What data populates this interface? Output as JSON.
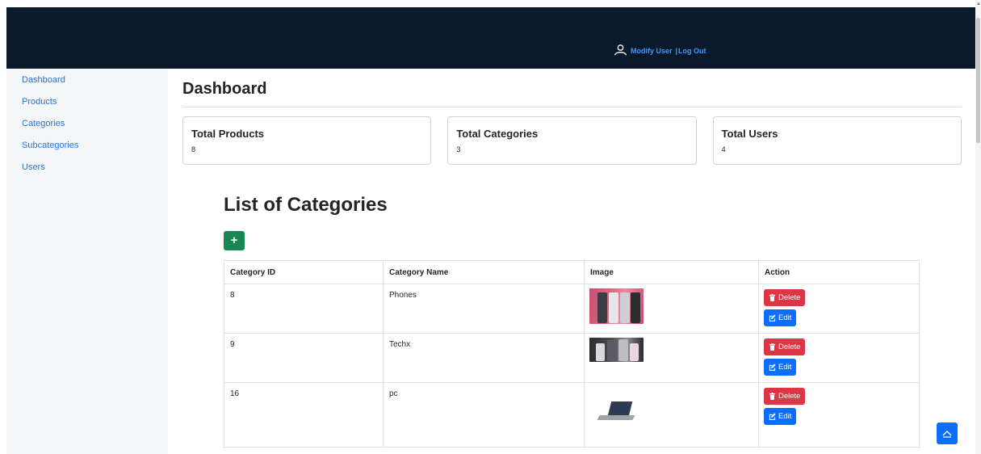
{
  "header": {
    "modify_user": "Modify User",
    "separator": "|",
    "logout": "Log Out"
  },
  "sidebar": {
    "items": [
      {
        "label": "Dashboard"
      },
      {
        "label": "Products"
      },
      {
        "label": "Categories"
      },
      {
        "label": "Subcategories"
      },
      {
        "label": "Users"
      }
    ]
  },
  "main": {
    "title": "Dashboard",
    "cards": [
      {
        "title": "Total Products",
        "value": "8"
      },
      {
        "title": "Total Categories",
        "value": "3"
      },
      {
        "title": "Total Users",
        "value": "4"
      }
    ],
    "list_title": "List of Categories",
    "add_label": "+",
    "table": {
      "headers": [
        "Category ID",
        "Category Name",
        "Image",
        "Action"
      ],
      "rows": [
        {
          "id": "8",
          "name": "Phones",
          "image": "phones-thumbnail"
        },
        {
          "id": "9",
          "name": "Techx",
          "image": "techx-thumbnail"
        },
        {
          "id": "16",
          "name": "pc",
          "image": "laptop-thumbnail"
        }
      ],
      "delete_label": "Delete",
      "edit_label": "Edit"
    }
  },
  "icons": {
    "user": "user-icon",
    "trash": "trash-icon",
    "edit": "edit-icon",
    "scroll_top": "chevron-up-icon"
  },
  "colors": {
    "topbar": "#0a1a2c",
    "link": "#2076e0",
    "add_button": "#198754",
    "delete_button": "#dc3545",
    "edit_button": "#0d6efd"
  }
}
